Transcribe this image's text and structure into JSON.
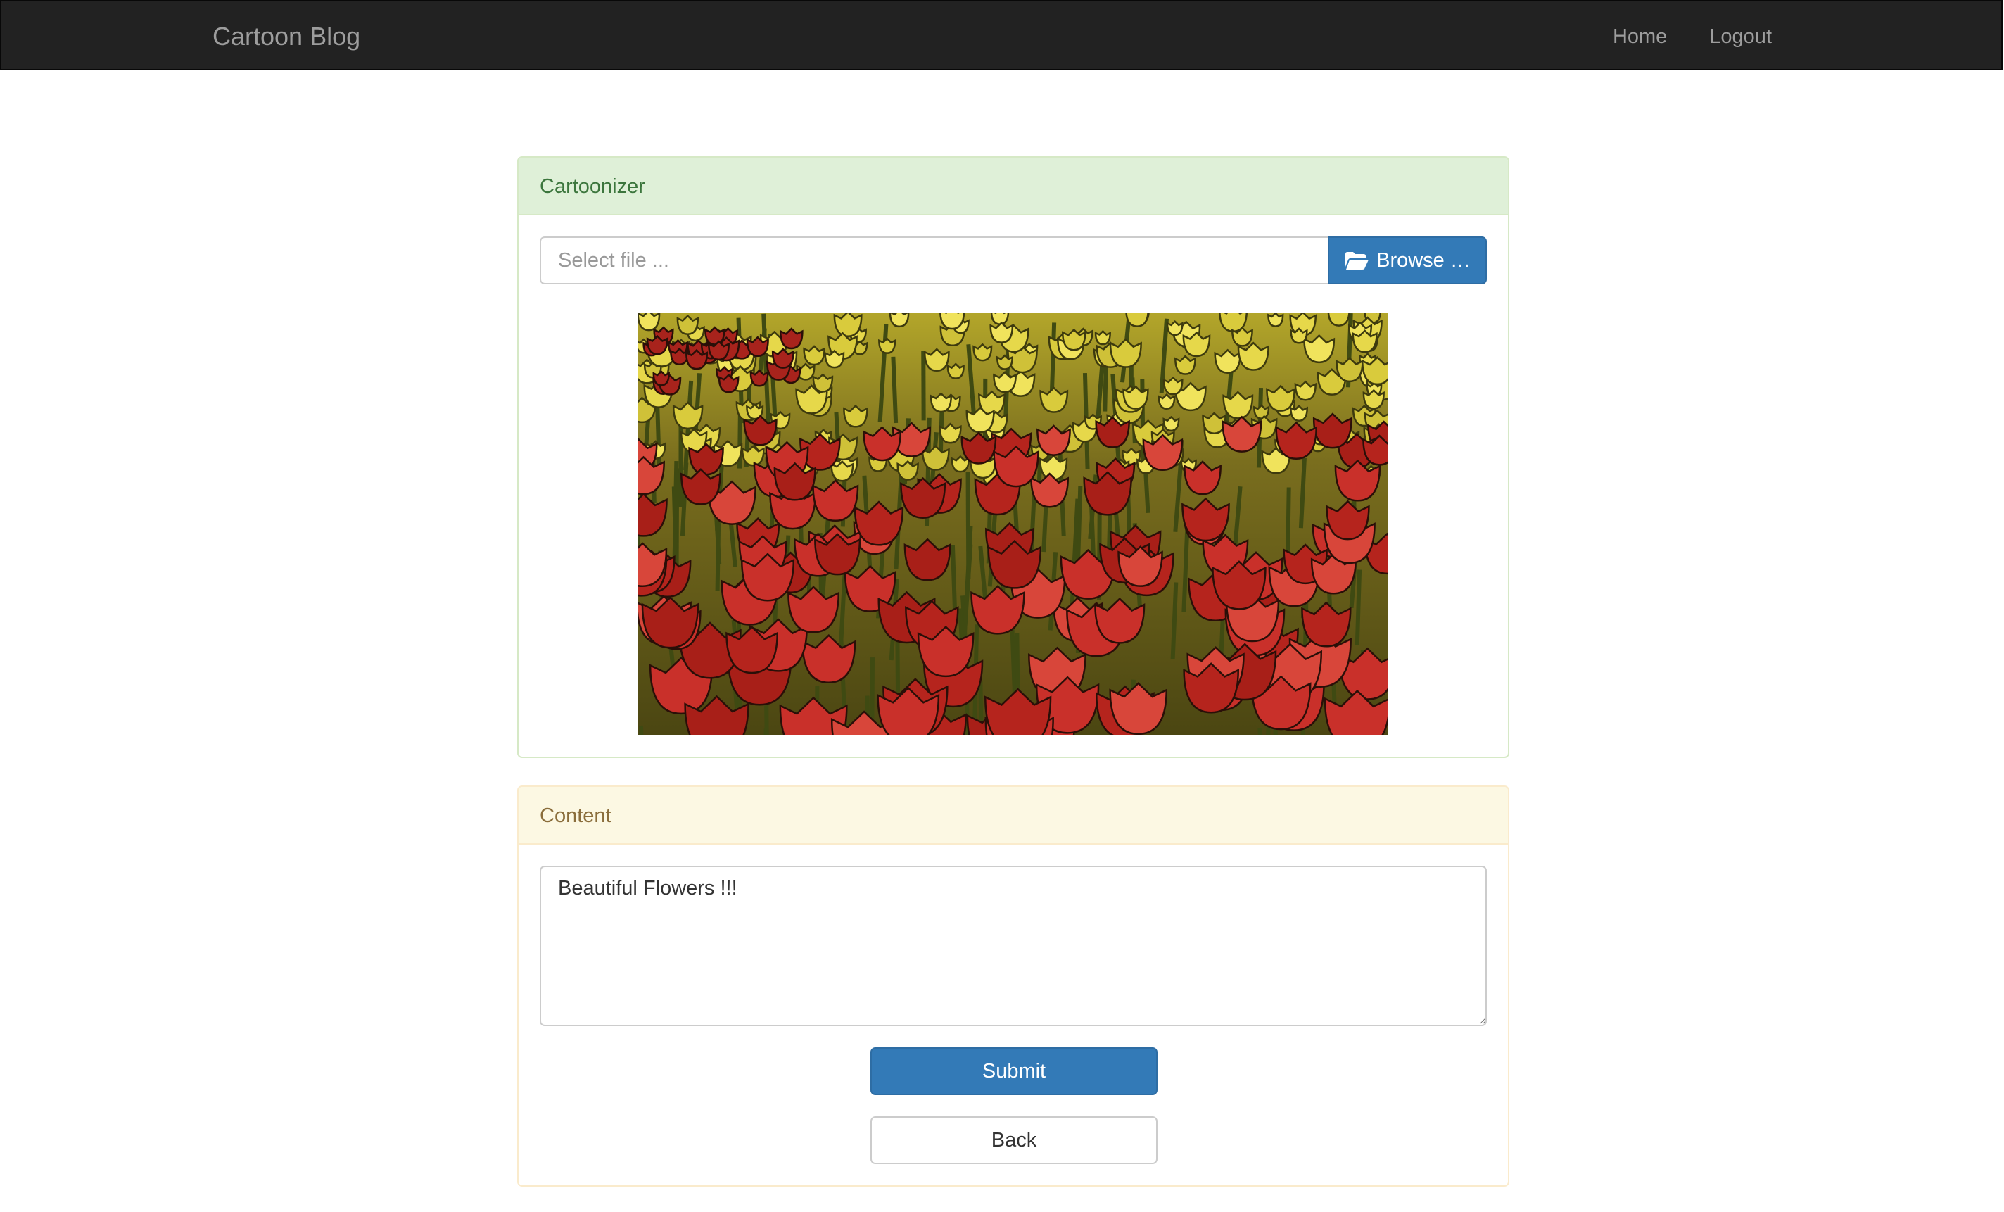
{
  "navbar": {
    "brand": "Cartoon Blog",
    "links": [
      "Home",
      "Logout"
    ]
  },
  "cartoonizer": {
    "heading": "Cartoonizer",
    "file_placeholder": "Select file ...",
    "browse_label": "Browse …",
    "browse_icon": "folder-open-icon"
  },
  "content": {
    "heading": "Content",
    "text": "Beautiful Flowers !!!",
    "submit_label": "Submit",
    "back_label": "Back"
  },
  "colors": {
    "navbar_bg": "#222222",
    "primary": "#337ab7",
    "success_heading_bg": "#dff0d8",
    "warning_heading_bg": "#fcf8e3"
  }
}
